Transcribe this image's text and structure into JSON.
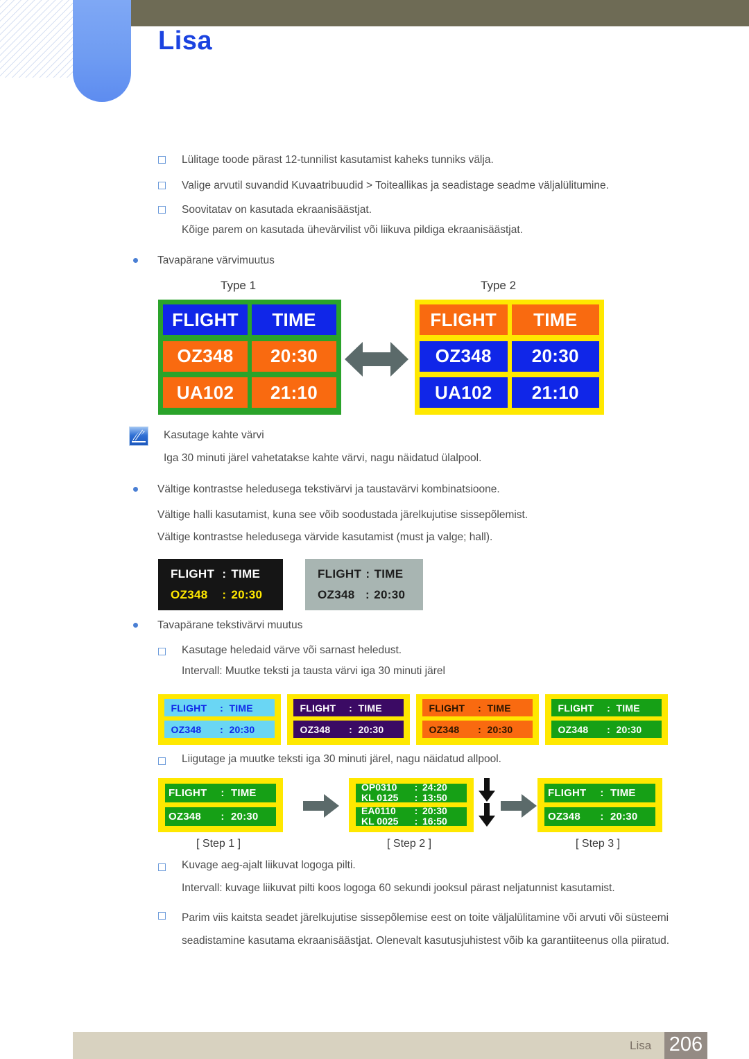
{
  "header": {
    "title": "Lisa",
    "title_color": "#1b43e0",
    "bar_color": "#6e6b55",
    "tab_color": "#6f9cf2"
  },
  "body": {
    "bullets_top": [
      "Lülitage toode pärast 12-tunnilist kasutamist kaheks tunniks välja.",
      "Valige arvutil suvandid Kuvaatribuudid > Toiteallikas ja seadistage seadme väljalülitumine.",
      "Soovitatav on kasutada ekraanisäästjat."
    ],
    "sub_top": "Kõige parem on kasutada ühevärvilist või liikuva pildiga ekraanisäästjat.",
    "heading_color_change": "Tavapärane värvimuutus",
    "note_title": "Kasutage kahte värvi",
    "note_text": "Iga 30 minuti järel vahetatakse kahte värvi, nagu näidatud ülalpool.",
    "avoid_bullet": "Vältige kontrastse heledusega tekstivärvi ja taustavärvi kombinatsioone.",
    "avoid_line1": "Vältige halli kasutamist, kuna see võib soodustada järelkujutise sissepõlemist.",
    "avoid_line2": "Vältige kontrastse heledusega värvide kasutamist (must ja valge; hall).",
    "heading_text_change": "Tavapärane tekstivärvi muutus",
    "bright_bullet": "Kasutage heledaid värve või sarnast heledust.",
    "interval_text": "Intervall: Muutke teksti ja tausta värvi iga 30 minuti järel",
    "move_bullet": "Liigutage ja muutke teksti iga 30 minuti järel, nagu näidatud allpool.",
    "logo_bullet": "Kuvage aeg-ajalt liikuvat logoga pilti.",
    "logo_interval": "Intervall: kuvage liikuvat pilti koos logoga 60 sekundi jooksul pärast neljatunnist kasutamist.",
    "best_way": "Parim viis kaitsta seadet järelkujutise sissepõlemise eest on toite väljalülitamine või arvuti või süsteemi seadistamine kasutama ekraanisäästjat. Olenevalt kasutusjuhistest võib ka garantiiteenus olla piiratud."
  },
  "type_boards": {
    "label1": "Type 1",
    "label2": "Type 2",
    "arrow": "double-headed-arrow",
    "headers": {
      "flight": "FLIGHT",
      "time": "TIME"
    },
    "rows": [
      {
        "flight": "OZ348",
        "time": "20:30"
      },
      {
        "flight": "UA102",
        "time": "21:10"
      }
    ],
    "type1": {
      "frame_color": "#2aa32a",
      "header_bg": "#1026e8",
      "header_fg": "#ffffff",
      "row_bg": "#f96a10",
      "row_fg": "#ffffff"
    },
    "type2": {
      "frame_color": "#ffe800",
      "header_bg": "#f96a10",
      "header_fg": "#ffffff",
      "row_bg": "#1026e8",
      "row_fg": "#ffffff"
    }
  },
  "contrast_boxes": [
    {
      "bg": "#151515",
      "header_fg": "#ffffff",
      "row_fg": "#ffe800",
      "flight_label": "FLIGHT",
      "time_label": "TIME",
      "sep": ":",
      "flight_value": "OZ348",
      "time_value": "20:30"
    },
    {
      "bg": "#a8b5b2",
      "header_fg": "#1d1d1d",
      "row_fg": "#1d1d1d",
      "flight_label": "FLIGHT",
      "time_label": "TIME",
      "sep": ":",
      "flight_value": "OZ348",
      "time_value": "20:30"
    }
  ],
  "mini_boards": {
    "frame_color": "#ffe800",
    "sep": ":",
    "flight_label": "FLIGHT",
    "time_label": "TIME",
    "flight_value": "OZ348",
    "time_value": "20:30",
    "variants": [
      {
        "strip_bg": "#6ad6f4",
        "strip_fg": "#1026e8"
      },
      {
        "strip_bg": "#3b0a64",
        "strip_fg": "#ffffff"
      },
      {
        "strip_bg": "#f96a10",
        "strip_fg": "#2a1400"
      },
      {
        "strip_bg": "#16a016",
        "strip_fg": "#ffffff"
      }
    ]
  },
  "step_diagram": {
    "frame_color": "#ffe800",
    "strip_bg": "#16a016",
    "strip_fg": "#ffffff",
    "sep": ":",
    "step1": {
      "flight_label": "FLIGHT",
      "time_label": "TIME",
      "flight_value": "OZ348",
      "time_value": "20:30"
    },
    "step2": {
      "strip_a": [
        {
          "flight": "OP0310",
          "time": "24:20"
        },
        {
          "flight": "KL 0125",
          "time": "13:50"
        }
      ],
      "strip_b": [
        {
          "flight": "EA0110",
          "time": "20:30"
        },
        {
          "flight": "KL 0025",
          "time": "16:50"
        }
      ]
    },
    "step3": {
      "flight_label": "FLIGHT",
      "time_label": "TIME",
      "flight_value": "OZ348",
      "time_value": "20:30"
    },
    "labels": {
      "step1": "[ Step 1 ]",
      "step2": "[ Step 2 ]",
      "step3": "[ Step 3 ]"
    },
    "right_arrow": "right-arrow",
    "down_arrow": "down-arrow"
  },
  "footer": {
    "name": "Lisa",
    "page": "206",
    "bar_color": "#d8d2c0",
    "num_box_color": "#948b84"
  }
}
